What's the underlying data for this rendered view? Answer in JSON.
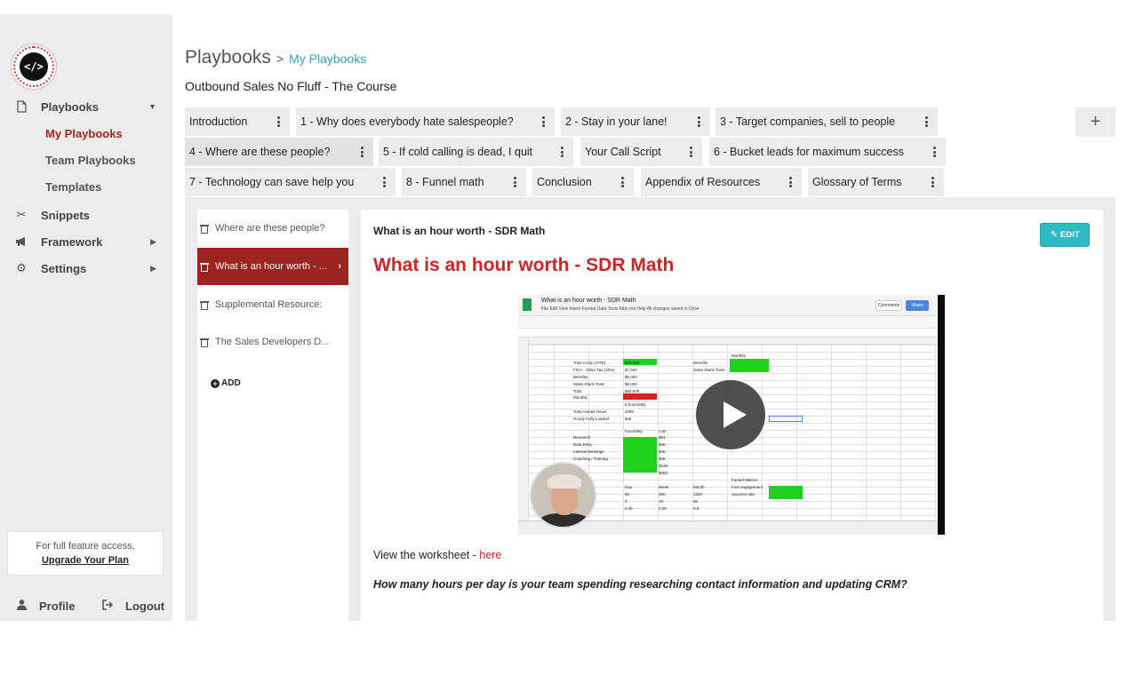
{
  "sidebar": {
    "logo_text": "</>",
    "items": [
      {
        "label": "Playbooks",
        "icon": "document-icon"
      },
      {
        "label": "Snippets",
        "icon": "scissors-icon"
      },
      {
        "label": "Framework",
        "icon": "megaphone-icon"
      },
      {
        "label": "Settings",
        "icon": "gears-icon"
      }
    ],
    "sub_items": [
      "My Playbooks",
      "Team Playbooks",
      "Templates"
    ],
    "upgrade_note": "For full feature access,",
    "upgrade_link": "Upgrade Your Plan",
    "profile_label": "Profile",
    "logout_label": "Logout"
  },
  "header": {
    "breadcrumb_root": "Playbooks",
    "breadcrumb_sep": ">",
    "breadcrumb_leaf": "My Playbooks",
    "course_title": "Outbound Sales No Fluff - The Course"
  },
  "tabs": [
    "Introduction",
    "1 - Why does everybody hate salespeople?",
    "2 - Stay in your lane!",
    "3 - Target companies, sell to people",
    "4 - Where are these people?",
    "5 - If cold calling is dead, I quit",
    "Your Call Script",
    "6 - Bucket leads for maximum success",
    "7 - Technology can save help you",
    "8 - Funnel math",
    "Conclusion",
    "Appendix of Resources",
    "Glossary of Terms"
  ],
  "add_tab_label": "+",
  "sections": [
    "Where are these people?",
    "What is an hour worth - ...",
    "Supplemental Resource:",
    "The Sales Developers D..."
  ],
  "add_section_label": "ADD",
  "doc": {
    "small_title": "What is an hour worth - SDR Math",
    "edit_label": "EDIT",
    "big_title": "What is an hour worth - SDR Math",
    "worksheet_prefix": "View the worksheet - ",
    "worksheet_link": "here",
    "question": "How many hours per day is your team spending researching contact information and updating CRM?"
  },
  "video": {
    "sheet_title": "What is an hour worth - SDR Math",
    "sheet_menus": "File   Edit   View   Insert   Format   Data   Tools   Add-ons   Help     All changes saved in Drive",
    "comments_label": "Comments",
    "share_label": "Share",
    "cells": [
      {
        "t": "Total Comp (OTE)",
        "c": "b"
      },
      {
        "t": "$75,000",
        "c": "c"
      },
      {
        "t": "FICA - Other Tax (10%)",
        "c": "b"
      },
      {
        "t": "$7,500",
        "c": "c"
      },
      {
        "t": "Benefits",
        "c": "b"
      },
      {
        "t": "$6,000",
        "c": "c"
      },
      {
        "t": "Sales Stack Tools",
        "c": "b"
      },
      {
        "t": "$6,000",
        "c": "c"
      },
      {
        "t": "Total",
        "c": "b"
      },
      {
        "t": "$94,500",
        "c": "c"
      },
      {
        "t": "Monthly",
        "c": "b"
      },
      {
        "t": "8 hours/day",
        "c": "c"
      },
      {
        "t": "Total Annual Hours",
        "c": "b"
      },
      {
        "t": "2080",
        "c": "c"
      },
      {
        "t": "Hourly Fully Loaded",
        "c": "b"
      },
      {
        "t": "$45",
        "c": "c"
      },
      {
        "t": "hours/day",
        "c": "c"
      },
      {
        "t": "cost",
        "c": "d"
      },
      {
        "t": "Research",
        "c": "b"
      },
      {
        "t": "$91",
        "c": "d"
      },
      {
        "t": "Data Entry",
        "c": "b"
      },
      {
        "t": "$45",
        "c": "d"
      },
      {
        "t": "Internal Meetings",
        "c": "b"
      },
      {
        "t": "$45",
        "c": "d"
      },
      {
        "t": "Coaching / Training",
        "c": "b"
      },
      {
        "t": "$45",
        "c": "d"
      },
      {
        "t": "$136",
        "c": "d"
      },
      {
        "t": "$363",
        "c": "d"
      },
      {
        "t": "Benefits",
        "c": "e"
      },
      {
        "t": "Sales Stack Tools",
        "c": "e"
      },
      {
        "t": "Monthly",
        "c": "f"
      },
      {
        "t": "Funnel Metrics",
        "c": "f"
      },
      {
        "t": "First engagement",
        "c": "f"
      },
      {
        "t": "Success rate",
        "c": "f"
      },
      {
        "t": "Day",
        "c": "c"
      },
      {
        "t": "Week",
        "c": "d"
      },
      {
        "t": "Month",
        "c": "e"
      },
      {
        "t": "60",
        "c": "c"
      },
      {
        "t": "300",
        "c": "d"
      },
      {
        "t": "1320",
        "c": "e"
      },
      {
        "t": "3",
        "c": "c"
      },
      {
        "t": "15",
        "c": "d"
      },
      {
        "t": "66",
        "c": "e"
      },
      {
        "t": "0.45",
        "c": "c"
      },
      {
        "t": "2.25",
        "c": "d"
      },
      {
        "t": "9.9",
        "c": "e"
      }
    ]
  },
  "colors": {
    "accent_red": "#d32323",
    "active_section": "#9b2320",
    "teal": "#2aa8b4",
    "edit_button": "#2fb9c0"
  }
}
